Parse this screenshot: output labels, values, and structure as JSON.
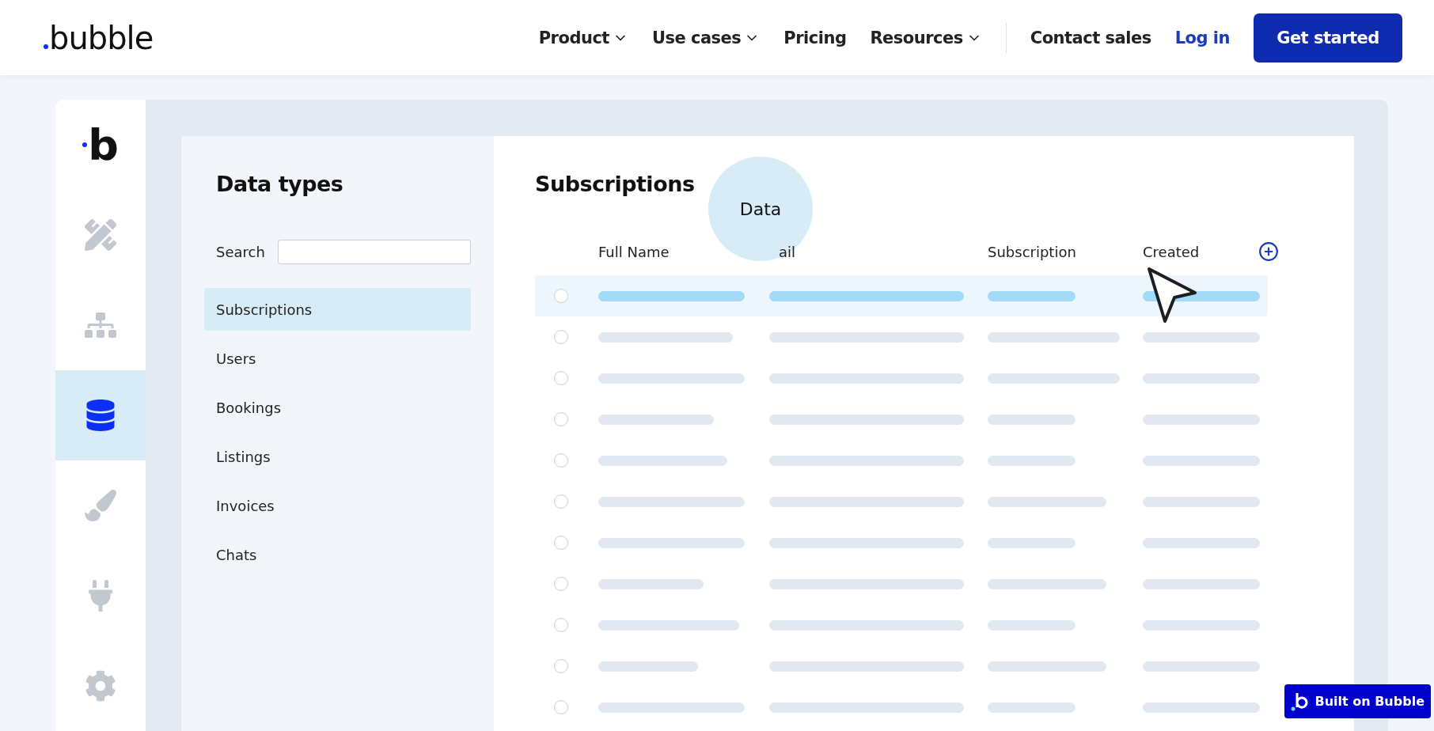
{
  "header": {
    "logo": "bubble",
    "nav": [
      {
        "label": "Product",
        "dropdown": true
      },
      {
        "label": "Use cases",
        "dropdown": true
      },
      {
        "label": "Pricing",
        "dropdown": false
      },
      {
        "label": "Resources",
        "dropdown": true
      }
    ],
    "contact": "Contact sales",
    "login": "Log in",
    "cta": "Get started"
  },
  "sidebar": {
    "logo": "b",
    "items": [
      {
        "kind": "design",
        "selected": false
      },
      {
        "kind": "workflow",
        "selected": false
      },
      {
        "kind": "data",
        "selected": true
      },
      {
        "kind": "styles",
        "selected": false
      },
      {
        "kind": "plugins",
        "selected": false
      },
      {
        "kind": "settings",
        "selected": false
      }
    ]
  },
  "data_types": {
    "title": "Data types",
    "search_label": "Search",
    "items": [
      {
        "label": "Subscriptions",
        "selected": true
      },
      {
        "label": "Users",
        "selected": false
      },
      {
        "label": "Bookings",
        "selected": false
      },
      {
        "label": "Listings",
        "selected": false
      },
      {
        "label": "Invoices",
        "selected": false
      },
      {
        "label": "Chats",
        "selected": false
      }
    ]
  },
  "table": {
    "title": "Subscriptions",
    "bubble": "Data",
    "columns": [
      "Full Name",
      "ail",
      "Subscription",
      "Created"
    ],
    "rows": [
      {
        "selected": true
      },
      {
        "selected": false
      },
      {
        "selected": false
      },
      {
        "selected": false
      },
      {
        "selected": false
      },
      {
        "selected": false
      },
      {
        "selected": false
      },
      {
        "selected": false
      },
      {
        "selected": false
      },
      {
        "selected": false
      },
      {
        "selected": false
      }
    ]
  },
  "badge": "Built on Bubble"
}
